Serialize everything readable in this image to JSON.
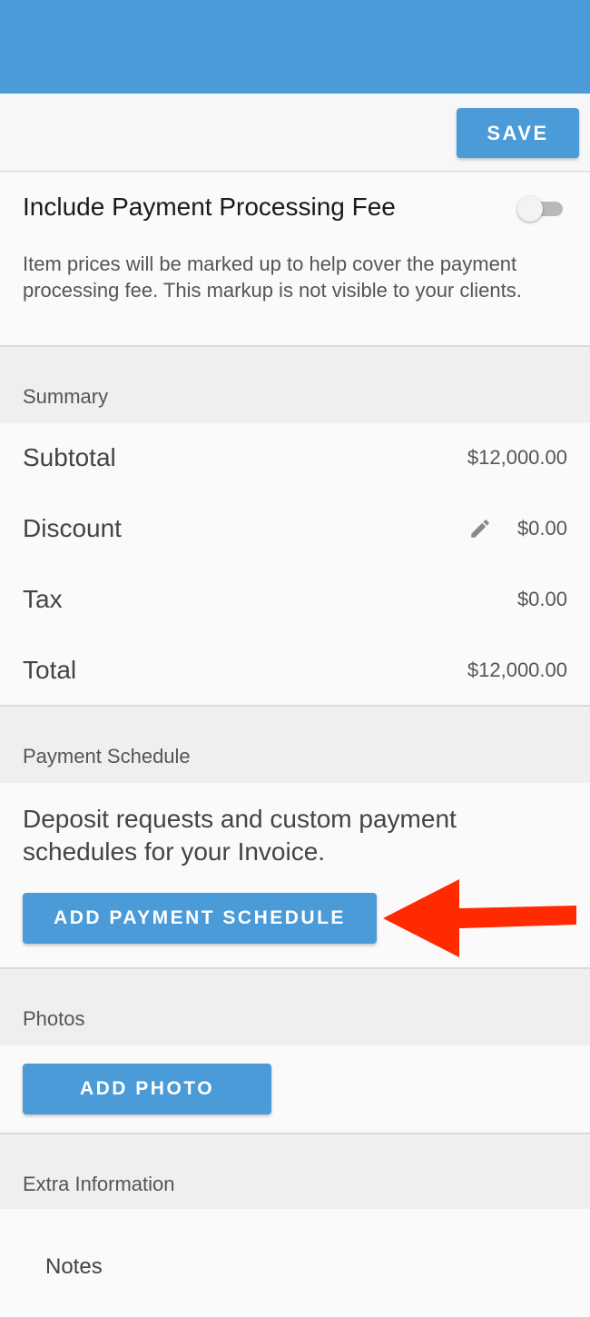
{
  "toolbar": {
    "save_label": "SAVE"
  },
  "payment_fee": {
    "title": "Include Payment Processing Fee",
    "enabled": false,
    "description": "Item prices will be marked up to help cover the payment processing fee. This markup is not visible to your clients."
  },
  "summary": {
    "header": "Summary",
    "rows": [
      {
        "label": "Subtotal",
        "value": "$12,000.00"
      },
      {
        "label": "Discount",
        "value": "$0.00"
      },
      {
        "label": "Tax",
        "value": "$0.00"
      },
      {
        "label": "Total",
        "value": "$12,000.00"
      }
    ]
  },
  "payment_schedule": {
    "header": "Payment Schedule",
    "description": "Deposit requests and custom payment schedules for your Invoice.",
    "button_label": "ADD PAYMENT SCHEDULE"
  },
  "photos": {
    "header": "Photos",
    "button_label": "ADD PHOTO"
  },
  "extra_information": {
    "header": "Extra Information",
    "notes_label": "Notes"
  },
  "colors": {
    "primary": "#4a9bd7",
    "annotation_arrow": "#ff2a00"
  },
  "icons": {
    "edit": "pencil-icon",
    "annotation": "red-arrow-icon"
  }
}
